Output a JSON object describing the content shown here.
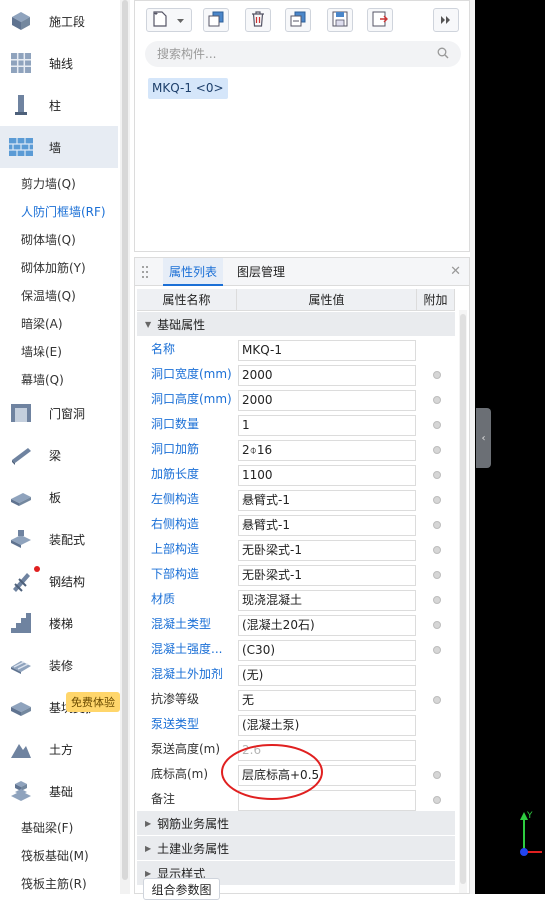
{
  "nav": {
    "categories_top": [
      {
        "label": "施工段",
        "icon": "construction-stage-icon"
      },
      {
        "label": "轴线",
        "icon": "axis-grid-icon"
      },
      {
        "label": "柱",
        "icon": "column-icon"
      },
      {
        "label": "墙",
        "icon": "wall-icon",
        "active": true
      }
    ],
    "wall_subitems": [
      "剪力墙(Q)",
      "人防门框墙(RF)",
      "砌体墙(Q)",
      "砌体加筋(Y)",
      "保温墙(Q)",
      "暗梁(A)",
      "墙垛(E)",
      "幕墙(Q)"
    ],
    "categories_mid": [
      {
        "label": "门窗洞",
        "icon": "door-window-icon"
      },
      {
        "label": "梁",
        "icon": "beam-icon"
      },
      {
        "label": "板",
        "icon": "slab-icon"
      },
      {
        "label": "装配式",
        "icon": "prefab-icon"
      },
      {
        "label": "钢结构",
        "icon": "steel-structure-icon"
      },
      {
        "label": "楼梯",
        "icon": "stairs-icon"
      },
      {
        "label": "装修",
        "icon": "decoration-icon"
      },
      {
        "label": "基坑支护",
        "icon": "foundation-pit-icon"
      },
      {
        "label": "土方",
        "icon": "earthwork-icon"
      },
      {
        "label": "基础",
        "icon": "foundation-icon"
      }
    ],
    "foundation_subitems": [
      "基础梁(F)",
      "筏板基础(M)",
      "筏板主筋(R)"
    ],
    "trial_badge": "免费体验"
  },
  "component_panel": {
    "search_placeholder": "搜索构件...",
    "selected_item": "MKQ-1 <0>"
  },
  "property_panel": {
    "tabs": [
      "属性列表",
      "图层管理"
    ],
    "columns": [
      "属性名称",
      "属性值",
      "附加"
    ],
    "groups": {
      "basic": "基础属性",
      "rebar": "钢筋业务属性",
      "civil": "土建业务属性",
      "display": "显示样式"
    },
    "rows": [
      {
        "name": "名称",
        "value": "MKQ-1",
        "blue": true,
        "dot": false
      },
      {
        "name": "洞口宽度(mm)",
        "value": "2000",
        "blue": true,
        "dot": true
      },
      {
        "name": "洞口高度(mm)",
        "value": "2000",
        "blue": true,
        "dot": true
      },
      {
        "name": "洞口数量",
        "value": "1",
        "blue": true,
        "dot": true
      },
      {
        "name": "洞口加筋",
        "value": "2⌽16",
        "blue": true,
        "dot": true
      },
      {
        "name": "加筋长度",
        "value": "1100",
        "blue": true,
        "dot": true
      },
      {
        "name": "左侧构造",
        "value": "悬臂式-1",
        "blue": true,
        "dot": true
      },
      {
        "name": "右侧构造",
        "value": "悬臂式-1",
        "blue": true,
        "dot": true
      },
      {
        "name": "上部构造",
        "value": "无卧梁式-1",
        "blue": true,
        "dot": true
      },
      {
        "name": "下部构造",
        "value": "无卧梁式-1",
        "blue": true,
        "dot": true
      },
      {
        "name": "材质",
        "value": "现浇混凝土",
        "blue": true,
        "dot": true
      },
      {
        "name": "混凝土类型",
        "value": "(混凝土20石)",
        "blue": true,
        "dot": true
      },
      {
        "name": "混凝土强度...",
        "value": "(C30)",
        "blue": true,
        "dot": true
      },
      {
        "name": "混凝土外加剂",
        "value": "(无)",
        "blue": true,
        "dot": false
      },
      {
        "name": "抗渗等级",
        "value": "无",
        "blue": false,
        "dot": true
      },
      {
        "name": "泵送类型",
        "value": "(混凝土泵)",
        "blue": true,
        "dot": false
      },
      {
        "name": "泵送高度(m)",
        "value": "2.6",
        "blue": false,
        "dot": false,
        "grey": true
      },
      {
        "name": "底标高(m)",
        "value": "层底标高+0.5",
        "blue": false,
        "dot": true
      },
      {
        "name": "备注",
        "value": "",
        "blue": false,
        "dot": true
      }
    ]
  },
  "footer": {
    "combo_button": "组合参数图"
  },
  "colors": {
    "accent_blue": "#1a6fd6",
    "annotation_red": "#e02020",
    "viewport_bg": "#000000"
  }
}
